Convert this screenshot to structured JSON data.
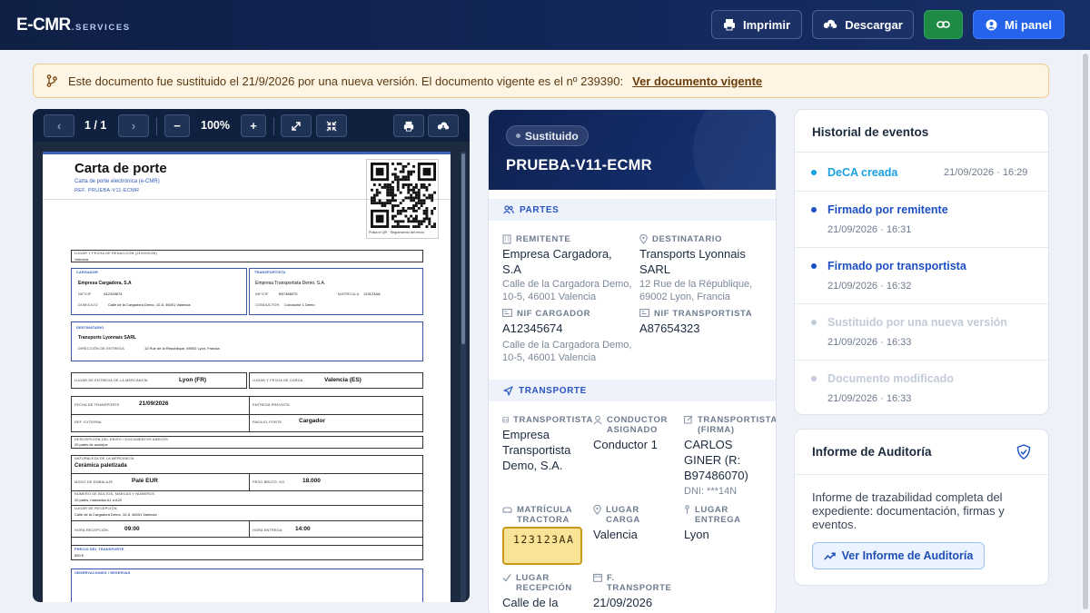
{
  "header": {
    "logo_main": "E-CMR",
    "logo_sub": ".SERVICES",
    "print_label": "Imprimir",
    "download_label": "Descargar",
    "panel_label": "Mi panel"
  },
  "banner": {
    "message": "Este documento fue sustituido el 21/9/2026 por una nueva versión. El documento vigente es el nº 239390:",
    "link": "Ver documento vigente"
  },
  "viewer": {
    "page_indicator": "1 / 1",
    "zoom": "100%",
    "doc": {
      "title": "Carta de porte",
      "subtitle": "Carta de porte electrónica (e-CMR)",
      "ref": "REF. PRUEBA-V11-ECMR",
      "qr_caption": "Pulsa el QR · Seguimiento del envío",
      "lugar_fecha_label": "LUGAR Y FECHA DE REDACCIÓN (21/09/2026)",
      "lugar_fecha_val": "Valencia",
      "cargador_label": "CARGADOR",
      "cargador_name": "Empresa Cargadora, S.A",
      "cargador_nif_label": "NIF/CIF",
      "cargador_nif": "A12345674",
      "cargador_dir_label": "DOMICILIO",
      "cargador_dir": "Calle de la Cargadora Demo, 10-5, 46001 Valencia",
      "transportista_label": "TRANSPORTISTA",
      "transportista_name": "Empresa Transportista Demo, S.A.",
      "transportista_nif_label": "NIF/CIF",
      "transportista_nif": "B97486070",
      "transportista_mat_label": "MATRÍCULA",
      "transportista_mat": "123123AA",
      "conductor_label": "CONDUCTOR",
      "conductor": "Conductor 1 Demo",
      "destinatario_label": "DESTINATARIO",
      "destinatario_name": "Transports Lyonnais SARL",
      "entrega_dir_label": "DIRECCIÓN DE ENTREGA",
      "entrega_dir": "12 Rue de la République, 69002 Lyon, Francia",
      "lugar_entrega_label": "LUGAR DE ENTREGA DE LA MERCANCÍA",
      "lugar_entrega": "Lyon (FR)",
      "lugar_carga_label": "LUGAR Y FECHA DE CARGA",
      "lugar_carga": "Valencia (ES)",
      "fecha_transporte_label": "FECHA DE TRANSPORTE",
      "fecha_transporte": "21/09/2026",
      "entrega_prevista_label": "ENTREGA PREVISTA",
      "ref_externa_label": "REF. EXTERNA",
      "paga_porte_label": "PAGA EL PORTE",
      "paga_porte": "Cargador",
      "descripcion_label": "DESCRIPCIÓN DEL ENVÍO / DOCUMENTOS ANEXOS",
      "descripcion": "20 palés de azulejos",
      "naturaleza_label": "NATURALEZA DE LA MERCANCÍA",
      "naturaleza": "Cerámica paletizada",
      "embalaje_label": "MODO DE EMBALAJE",
      "embalaje": "Palé EUR",
      "peso_label": "PESO BRUTO, KG",
      "peso": "18.000",
      "bultos_label": "NÚMERO DE BULTOS, MARCAS Y NÚMEROS",
      "bultos": "20 palés, marcados A1 a A20",
      "recepcion_label": "LUGAR DE RECEPCIÓN",
      "recepcion": "Calle de la Cargadora Demo, 10-5, 46001 Valencia",
      "hora_recepcion_label": "HORA RECEPCIÓN",
      "hora_recepcion": "09:00",
      "hora_entrega_label": "HORA ENTREGA",
      "hora_entrega": "14:00",
      "precio_label": "PRECIO DEL TRANSPORTE",
      "precio": "650 €",
      "observaciones_label": "OBSERVACIONES / RESERVAS"
    }
  },
  "summary": {
    "status": "Sustituido",
    "code": "PRUEBA-V11-ECMR",
    "partes_title": "PARTES",
    "remitente_label": "REMITENTE",
    "remitente_name": "Empresa Cargadora, S.A",
    "remitente_addr": "Calle de la Cargadora Demo, 10-5, 46001 Valencia",
    "destinatario_label": "DESTINATARIO",
    "destinatario_name": "Transports Lyonnais SARL",
    "destinatario_addr": "12 Rue de la République, 69002 Lyon, Francia",
    "nif_cargador_label": "NIF CARGADOR",
    "nif_cargador": "A12345674",
    "nif_cargador_addr": "Calle de la Cargadora Demo, 10-5, 46001 Valencia",
    "nif_transportista_label": "NIF TRANSPORTISTA",
    "nif_transportista": "A87654323",
    "transporte_title": "TRANSPORTE",
    "transportista_label": "TRANSPORTISTA",
    "transportista_name": "Empresa Transportista Demo, S.A.",
    "conductor_label": "CONDUCTOR ASIGNADO",
    "conductor": "Conductor 1",
    "firma_label": "TRANSPORTISTA (FIRMA)",
    "firma_name": "CARLOS GINER (R: B97486070)",
    "firma_dni": "DNI: ***14N",
    "matricula_label": "MATRÍCULA TRACTORA",
    "matricula": "123123AA",
    "lugar_carga_label": "LUGAR CARGA",
    "lugar_carga": "Valencia",
    "lugar_entrega_label": "LUGAR ENTREGA",
    "lugar_entrega": "Lyon",
    "lugar_recepcion_label": "LUGAR RECEPCIÓN",
    "lugar_recepcion": "Calle de la",
    "f_transporte_label": "F. TRANSPORTE",
    "f_transporte": "21/09/2026"
  },
  "history": {
    "title": "Historial de eventos",
    "events": [
      {
        "title": "DeCA creada",
        "time": "21/09/2026 · 16:29",
        "color": "#1aa0e0"
      },
      {
        "title": "Firmado por remitente",
        "time": "21/09/2026 · 16:31",
        "color": "#1d4fc4"
      },
      {
        "title": "Firmado por transportista",
        "time": "21/09/2026 · 16:32",
        "color": "#1d4fc4"
      },
      {
        "title": "Sustituido por una nueva versión",
        "time": "21/09/2026 · 16:33",
        "color": "#c3cbd8"
      },
      {
        "title": "Documento modificado",
        "time": "21/09/2026 · 16:33",
        "color": "#c3cbd8"
      }
    ]
  },
  "audit": {
    "title": "Informe de Auditoría",
    "description": "Informe de trazabilidad completa del expediente: documentación, firmas y eventos.",
    "button": "Ver Informe de Auditoría"
  }
}
